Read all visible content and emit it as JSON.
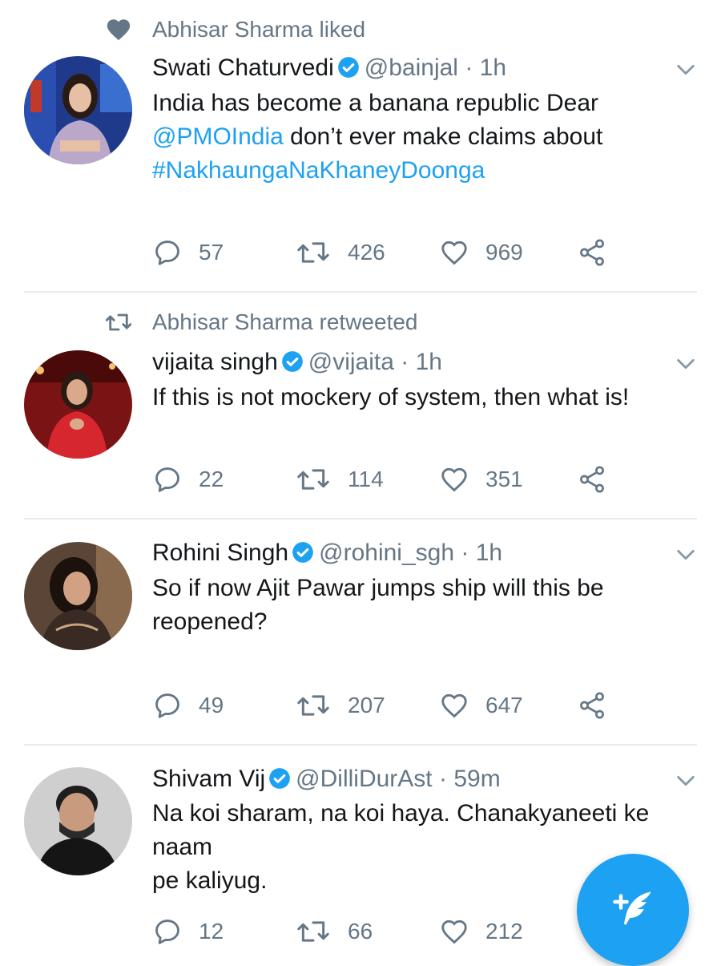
{
  "feed": {
    "tweets": [
      {
        "social_context": "Abhisar Sharma liked",
        "social_icon": "heart-icon",
        "name": "Swati Chaturvedi",
        "handle": "@bainjal",
        "dot": "·",
        "time": "1h",
        "text_parts": [
          "India has become a banana republic Dear",
          "@PMOIndia",
          " don’t ever make claims about",
          "#NakhaungaNaKhaneyDoonga"
        ],
        "replies": "57",
        "retweets": "426",
        "likes": "969"
      },
      {
        "social_context": "Abhisar Sharma retweeted",
        "social_icon": "retweet-icon",
        "name": "vijaita singh",
        "handle": "@vijaita",
        "dot": "·",
        "time": "1h",
        "text": "If this is not mockery of system, then what is!",
        "replies": "22",
        "retweets": "114",
        "likes": "351"
      },
      {
        "name": "Rohini Singh",
        "handle": "@rohini_sgh",
        "dot": "·",
        "time": "1h",
        "text_lines": [
          "So if now Ajit Pawar jumps ship will this be",
          "reopened?"
        ],
        "replies": "49",
        "retweets": "207",
        "likes": "647"
      },
      {
        "name": "Shivam Vij",
        "handle": "@DilliDurAst",
        "dot": "·",
        "time": "59m",
        "text_lines": [
          "Na koi sharam, na koi haya. Chanakyaneeti ke naam",
          "pe kaliyug."
        ],
        "replies": "12",
        "retweets": "66",
        "likes": "212"
      }
    ]
  },
  "colors": {
    "accent": "#1da1f2",
    "secondary_text": "#657786",
    "divider": "#e6ecf0"
  },
  "fab": {
    "icon": "compose-tweet-icon"
  }
}
